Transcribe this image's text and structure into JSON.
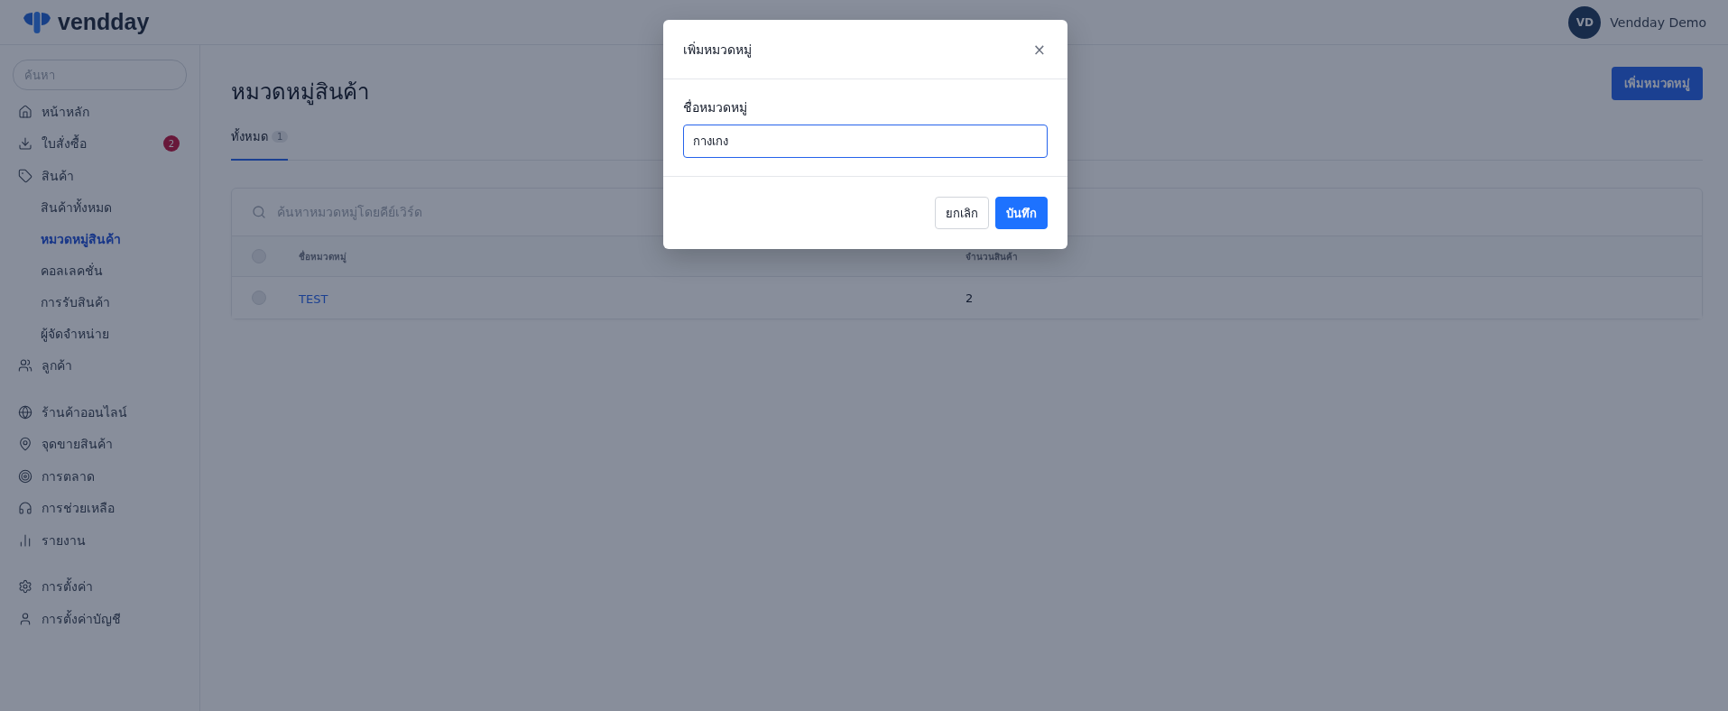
{
  "header": {
    "logo_text": "vendday",
    "user": {
      "initials": "VD",
      "name": "Vendday Demo"
    }
  },
  "sidebar": {
    "search": {
      "placeholder": "ค้นหา"
    },
    "groups": [
      {
        "items": [
          {
            "kind": "home",
            "label": "หน้าหลัก",
            "selected": false
          },
          {
            "kind": "orders",
            "label": "ใบสั่งซื้อ",
            "badge": "2",
            "selected": false
          },
          {
            "kind": "products",
            "label": "สินค้า",
            "selected": false,
            "children": [
              {
                "label": "สินค้าทั้งหมด",
                "selected": false
              },
              {
                "label": "หมวดหมู่สินค้า",
                "selected": true
              },
              {
                "label": "คอลเลคชั่น",
                "selected": false
              },
              {
                "label": "การรับสินค้า",
                "selected": false
              },
              {
                "label": "ผู้จัดจำหน่าย",
                "selected": false
              }
            ]
          },
          {
            "kind": "customers",
            "label": "ลูกค้า",
            "selected": false
          }
        ]
      },
      {
        "items": [
          {
            "kind": "online",
            "label": "ร้านค้าออนไลน์",
            "selected": false
          },
          {
            "kind": "pos",
            "label": "จุดขายสินค้า",
            "selected": false
          },
          {
            "kind": "marketing",
            "label": "การตลาด",
            "selected": false
          },
          {
            "kind": "support",
            "label": "การช่วยเหลือ",
            "selected": false
          },
          {
            "kind": "reports",
            "label": "รายงาน",
            "selected": false
          }
        ]
      },
      {
        "items": [
          {
            "kind": "settings",
            "label": "การตั้งค่า",
            "selected": false
          },
          {
            "kind": "account",
            "label": "การตั้งค่าบัญชี",
            "selected": false
          }
        ]
      }
    ]
  },
  "page": {
    "title": "หมวดหมู่สินค้า",
    "add_button": "เพิ่มหมวดหมู่",
    "tabs": [
      {
        "label": "ทั้งหมด",
        "count": "1",
        "selected": true
      }
    ],
    "search": {
      "placeholder": "ค้นหาหมวดหมู่โดยคีย์เวิร์ด"
    },
    "table": {
      "header_checked": false,
      "columns": [
        "ชื่อหมวดหมู่",
        "จำนวนสินค้า"
      ],
      "rows": [
        {
          "checked": false,
          "name": "TEST",
          "count": "2"
        }
      ]
    }
  },
  "modal": {
    "title": "เพิ่มหมวดหมู่",
    "close": "×",
    "field": {
      "label": "ชื่อหมวดหมู่",
      "value": "กางเกง"
    },
    "buttons": [
      {
        "kind": "secondary",
        "label": "ยกเลิก"
      },
      {
        "kind": "primary",
        "label": "บันทึก"
      }
    ]
  }
}
